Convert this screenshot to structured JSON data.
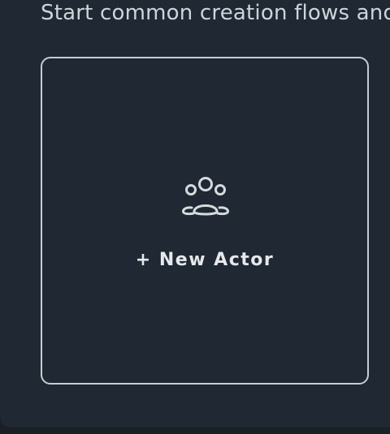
{
  "header": {
    "subtitle": "Start common creation flows and"
  },
  "card": {
    "label": "+ New Actor",
    "icon": "group-users-icon"
  },
  "colors": {
    "background": "#1f2833",
    "card_border": "#c9cdd2",
    "text": "#e6e8eb"
  }
}
